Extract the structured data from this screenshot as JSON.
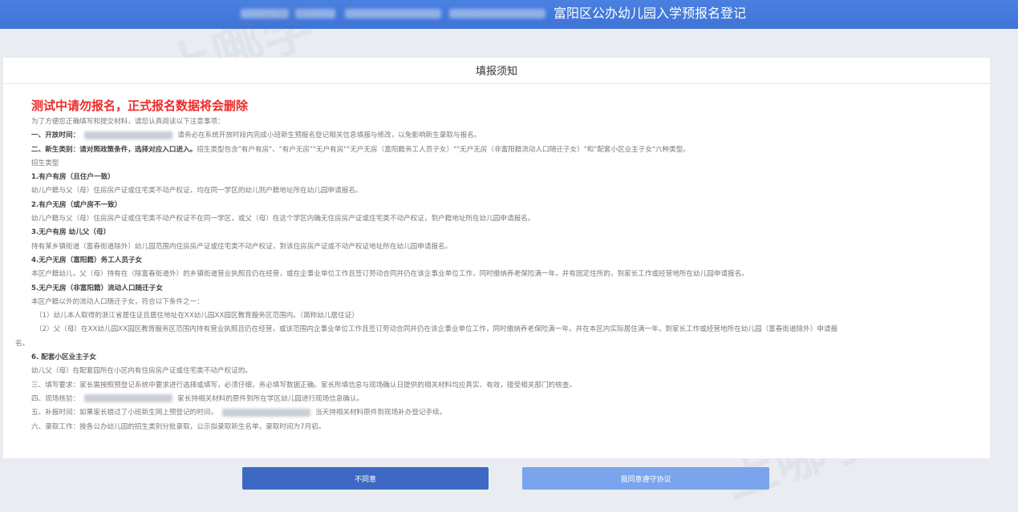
{
  "header": {
    "title": "富阳区公办幼儿园入学预报名登记"
  },
  "watermark": "上哪学",
  "panel": {
    "title": "填报须知",
    "red_notice": "测试中请勿报名，正式报名数据将会删除",
    "lines": [
      "为了方便您正确填写和提交材料，请您认真阅读以下注意事项：",
      "一、开放时间：",
      "请务必在系统开放时段内完成小班新生预报名登记相关信息填报与修改，以免影响新生录取与报名。",
      "二、新生类别：请对照政策条件，选择对应入口进入。",
      "招生类型包含\"有户有房\"、\"有户无房\"\"无户有房\"\"无户无房（富阳籍务工人员子女）\"\"无户无房（非富阳籍流动人口随迁子女）\"和\"配套小区业主子女\"六种类型。",
      "招生类型",
      "1.有户有房（且住户一致）",
      "幼儿户籍与父（母）住房房产证或住宅类不动产权证，均在同一学区的幼儿则户籍地址所在幼儿园申请报名。",
      "2.有户无房（或户房不一致）",
      "幼儿户籍与父（母）住房房产证或住宅类不动产权证不在同一学区，或父（母）在这个学区内确无住房房产证或住宅类不动产权证，到户籍地址所在幼儿园申请报名。",
      "3.无户有房 幼儿父（母）",
      "持有某乡镇街道（富春街道除外）幼儿园范围内住房房产证或住宅类不动产权证，到该住房房产证或不动产权证地址所在幼儿园申请报名。",
      "4.无户无房（富阳籍）务工人员子女",
      "本区户籍幼儿，父（母）持有在（除富春街道外）的乡镇街道营业执照且仍在经营，或在企事业单位工作且签订劳动合同并仍在该企事业单位工作，同时缴纳养老保险满一年，并有固定住所的，到家长工作或经营地所在幼儿园申请报名。",
      "5.无户无房（非富阳籍）流动人口随迁子女",
      "本区户籍以外的流动人口随迁子女，符合以下条件之一：",
      "（1）幼儿本人取得的浙江省居住证且居住地址在XX幼儿园XX园区教育服务区范围内。（简称幼儿居住证）",
      "（2）父（母）在XX幼儿园XX园区教育服务区范围内持有营业执照且仍在经营，或该范围内企事业单位工作且签订劳动合同并仍在该企事业单位工作，同时缴纳养老保险满一年，并在本区内实际居住满一年，到家长工作或经营地所在幼儿园（富春街道除外）申请报",
      "名。",
      "6. 配套小区业主子女",
      "幼儿父（母）在配套园所在小区内有住房房产证或住宅类不动产权证的。",
      "三、填写要求：家长需按照预登记系统中要求进行选择或填写，必须仔细，务必填写数据正确。家长所填信息与现场确认日提供的相关材料均应真实、有效，接受相关部门的核查。",
      "四、现场核验：",
      "家长持相关材料的原件到所在学区幼儿园进行现场信息确认。",
      "五、补报时间：如果家长错过了小班新生网上预登记的时间，",
      "当天持相关材料原件到现场补办登记手续。",
      "六、录取工作：按各公办幼儿园的招生类别分批录取，公示拟录取新生名单，录取时间为7月初。"
    ]
  },
  "buttons": {
    "disagree": "不同意",
    "agree": "我同意遵守协议"
  }
}
